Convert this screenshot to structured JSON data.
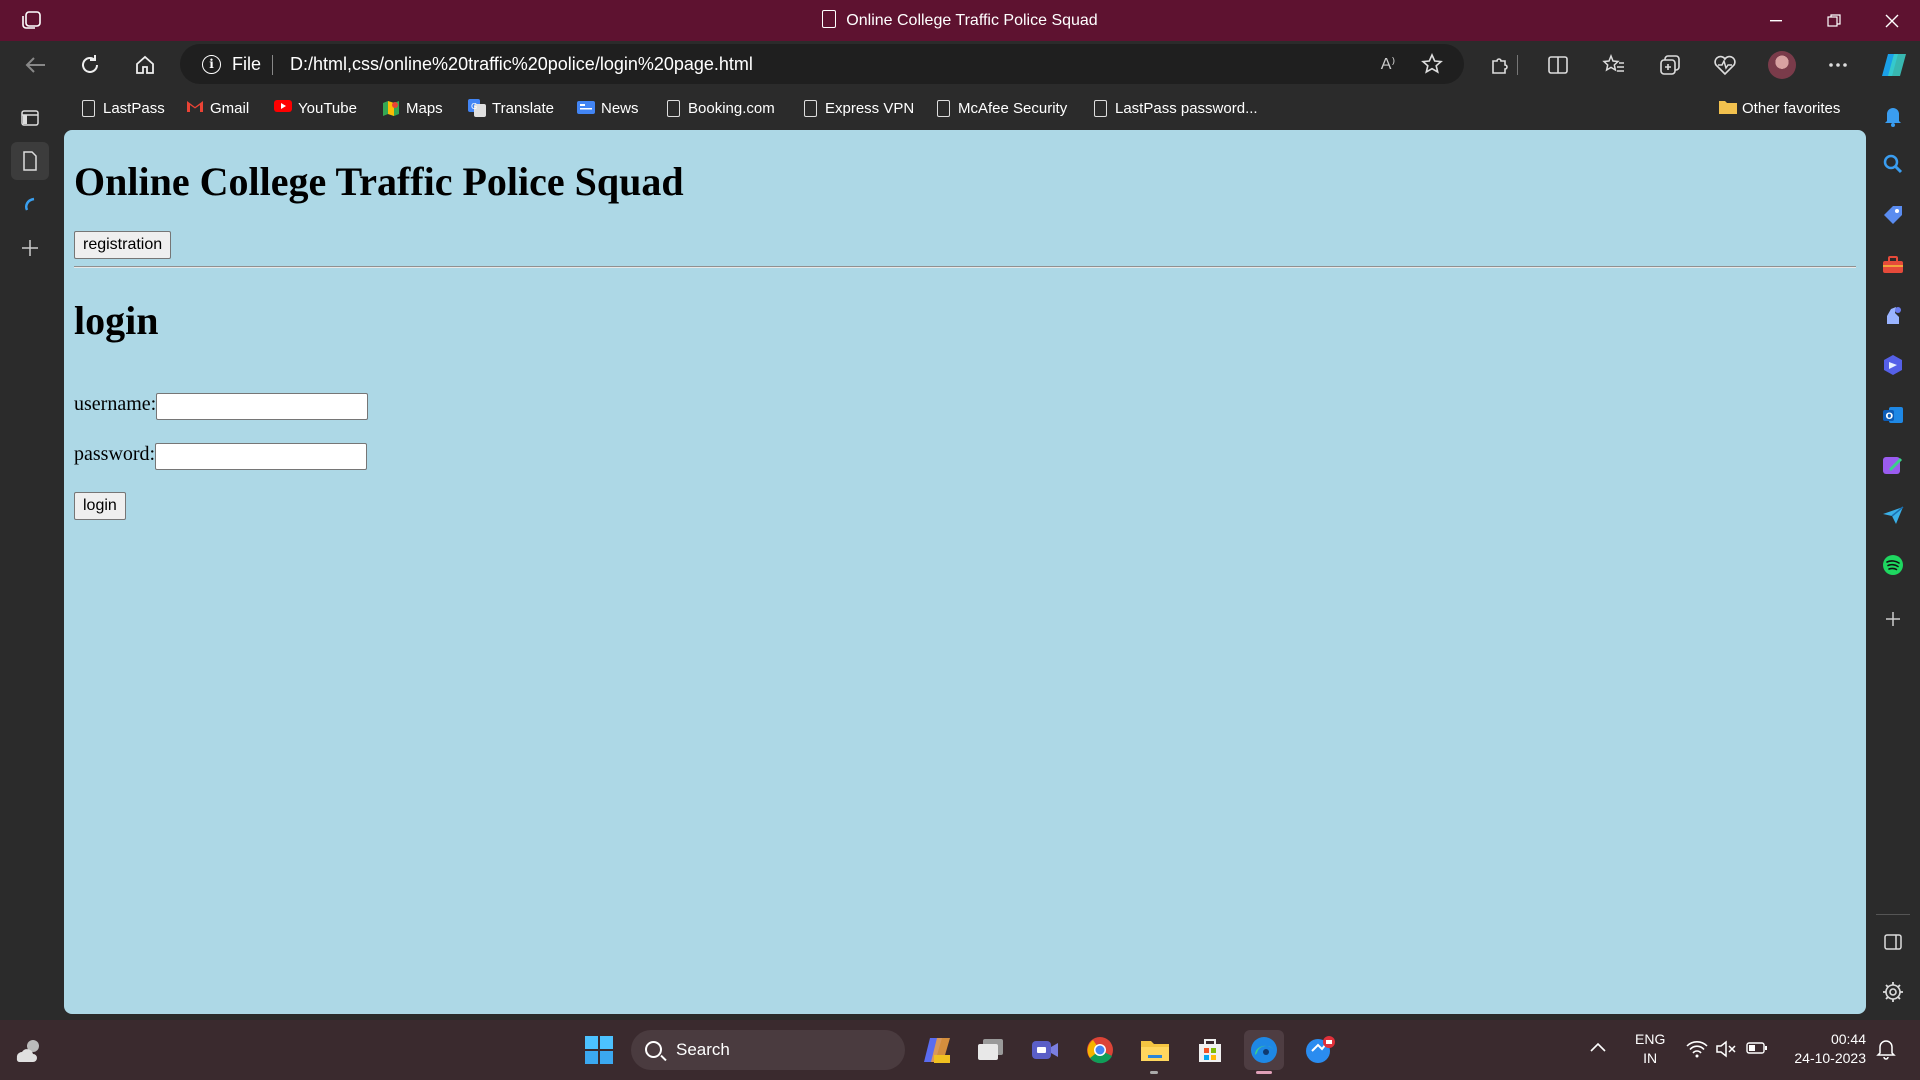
{
  "window": {
    "title": "Online College Traffic Police Squad"
  },
  "addressbar": {
    "scheme_label": "File",
    "url": "D:/html,css/online%20traffic%20police/login%20page.html",
    "read_aloud_label": "A⁾"
  },
  "bookmarks": [
    {
      "label": "LastPass",
      "icon": "page-icon"
    },
    {
      "label": "Gmail",
      "icon": "gmail-icon"
    },
    {
      "label": "YouTube",
      "icon": "youtube-icon"
    },
    {
      "label": "Maps",
      "icon": "maps-icon"
    },
    {
      "label": "Translate",
      "icon": "translate-icon"
    },
    {
      "label": "News",
      "icon": "news-icon"
    },
    {
      "label": "Booking.com",
      "icon": "page-icon"
    },
    {
      "label": "Express VPN",
      "icon": "page-icon"
    },
    {
      "label": "McAfee Security",
      "icon": "page-icon"
    },
    {
      "label": "LastPass password...",
      "icon": "page-icon"
    }
  ],
  "other_favorites": "Other favorites",
  "page": {
    "heading": "Online College Traffic Police Squad",
    "registration_button": "registration",
    "login_heading": "login",
    "username_label": "username:",
    "username_value": "",
    "password_label": "password:",
    "password_value": "",
    "login_button": "login"
  },
  "taskbar": {
    "search_placeholder": "Search",
    "language": "ENG",
    "region": "IN",
    "time": "00:44",
    "date": "24-10-2023"
  },
  "colors": {
    "titlebar": "#5e1230",
    "page_background": "#add8e6",
    "browser_chrome": "#2b2b2b",
    "taskbar": "#3a2a2e"
  }
}
